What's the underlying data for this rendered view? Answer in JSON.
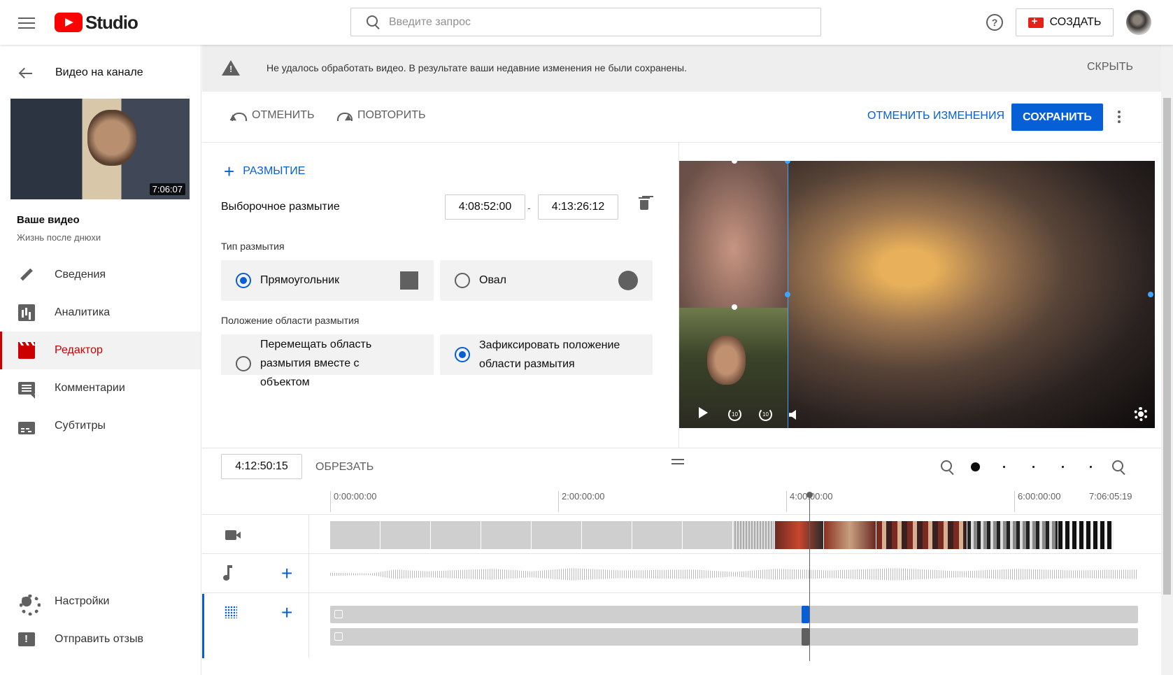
{
  "app": {
    "logo_text": "Studio",
    "accent": "#065fd4",
    "brand_red": "#ff0000"
  },
  "search": {
    "placeholder": "Введите запрос"
  },
  "header": {
    "help_icon": "help-icon",
    "create_label": "СОЗДАТЬ"
  },
  "sidebar": {
    "back_title": "Видео на канале",
    "thumbnail_duration": "7:06:07",
    "your_video_label": "Ваше видео",
    "video_title": "Жизнь после днюхи",
    "items": [
      {
        "label": "Сведения",
        "icon": "pencil-icon"
      },
      {
        "label": "Аналитика",
        "icon": "analytics-icon"
      },
      {
        "label": "Редактор",
        "icon": "editor-icon",
        "active": true
      },
      {
        "label": "Комментарии",
        "icon": "comments-icon"
      },
      {
        "label": "Субтитры",
        "icon": "subtitles-icon"
      }
    ],
    "bottom_items": [
      {
        "label": "Настройки",
        "icon": "gear-icon"
      },
      {
        "label": "Отправить отзыв",
        "icon": "feedback-icon"
      }
    ]
  },
  "alert": {
    "text": "Не удалось обработать видео. В результате ваши недавние изменения не были сохранены.",
    "hide_label": "СКРЫТЬ"
  },
  "toolbar": {
    "undo_label": "ОТМЕНИТЬ",
    "redo_label": "ПОВТОРИТЬ",
    "discard_label": "ОТМЕНИТЬ ИЗМЕНЕНИЯ",
    "save_label": "СОХРАНИТЬ"
  },
  "blur_panel": {
    "add_label": "РАЗМЫТИЕ",
    "blur_name": "Выборочное размытие",
    "start_time": "4:08:52:00",
    "end_time": "4:13:26:12",
    "time_separator": "-",
    "type_label": "Тип размытия",
    "type_options": [
      {
        "label": "Прямоугольник",
        "selected": true
      },
      {
        "label": "Овал",
        "selected": false
      }
    ],
    "position_label": "Положение области размытия",
    "position_options": [
      {
        "label": "Перемещать область размытия вместе с объектом",
        "selected": false
      },
      {
        "label": "Зафиксировать положение области размытия",
        "selected": true
      }
    ]
  },
  "timeline": {
    "current_time": "4:12:50:15",
    "trim_label": "ОБРЕЗАТЬ",
    "ticks": [
      "0:00:00:00",
      "2:00:00:00",
      "4:00:00:00",
      "6:00:00:00",
      "7:06:05:19"
    ],
    "zoom_level_steps": 5,
    "zoom_level_selected": 0
  }
}
